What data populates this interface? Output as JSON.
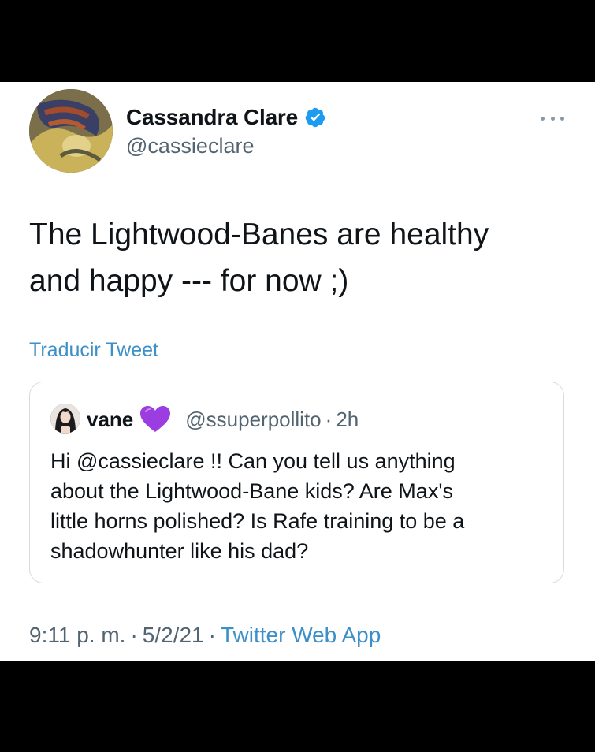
{
  "author": {
    "name": "Cassandra Clare",
    "handle": "@cassieclare",
    "verified": true,
    "avatar_icon": "profile-photo"
  },
  "menu": {
    "icon": "more-dots-icon"
  },
  "tweet": {
    "text_lines": [
      "The Lightwood-Banes are healthy",
      "and happy --- for now ;)"
    ]
  },
  "translate_link": "Traducir Tweet",
  "quoted_tweet": {
    "name": "vane",
    "emoji_icon": "purple-heart-icon",
    "handle": "@ssuperpollito",
    "separator": "·",
    "time": "2h",
    "text_lines": [
      "Hi @cassieclare !! Can you tell us anything",
      "about the Lightwood-Bane kids? Are Max's",
      "little horns polished? Is Rafe training to be a",
      "shadowhunter like his dad?"
    ]
  },
  "meta": {
    "time": "9:11 p. m.",
    "separator": "·",
    "date": "5/2/21",
    "source": "Twitter Web App"
  },
  "colors": {
    "link": "#3d8fc7",
    "verified": "#1d9bf0",
    "heart": "#9b3de0",
    "text": "#0f1419",
    "muted": "#536471"
  }
}
